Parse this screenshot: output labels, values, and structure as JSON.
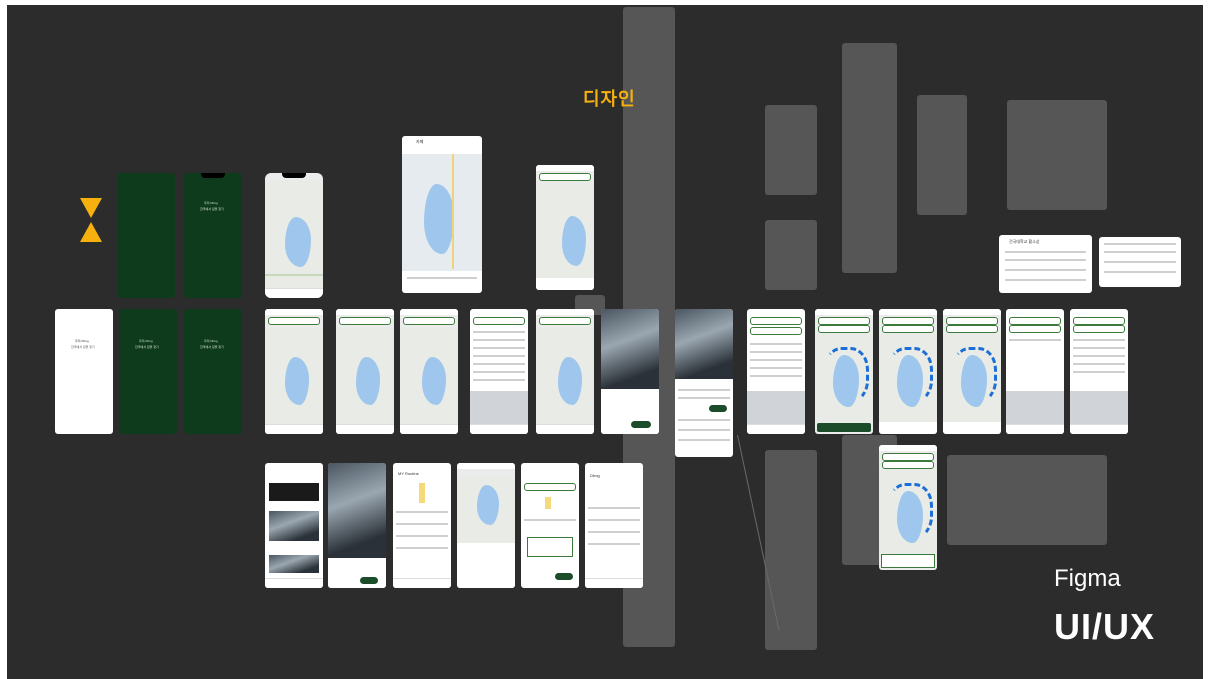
{
  "canvas": {
    "background": "#2c2c2c",
    "accent": "#f6b10f",
    "brand_green": "#0f3b1d",
    "route_blue": "#1c6fd6"
  },
  "labels": {
    "design": "디자인",
    "figma": "Figma",
    "uiux": "UI/UX"
  },
  "icons": {
    "hourglass": "hourglass-icon"
  },
  "splash": {
    "title": "우리 Dfrog",
    "subtitle": "한국에서 길을 찾기"
  },
  "screens": {
    "search_title": "카페",
    "route_title": "MY Routine",
    "settings_title": "Dfrog",
    "bottom_sheet_title": "건국대학교 황소상"
  }
}
